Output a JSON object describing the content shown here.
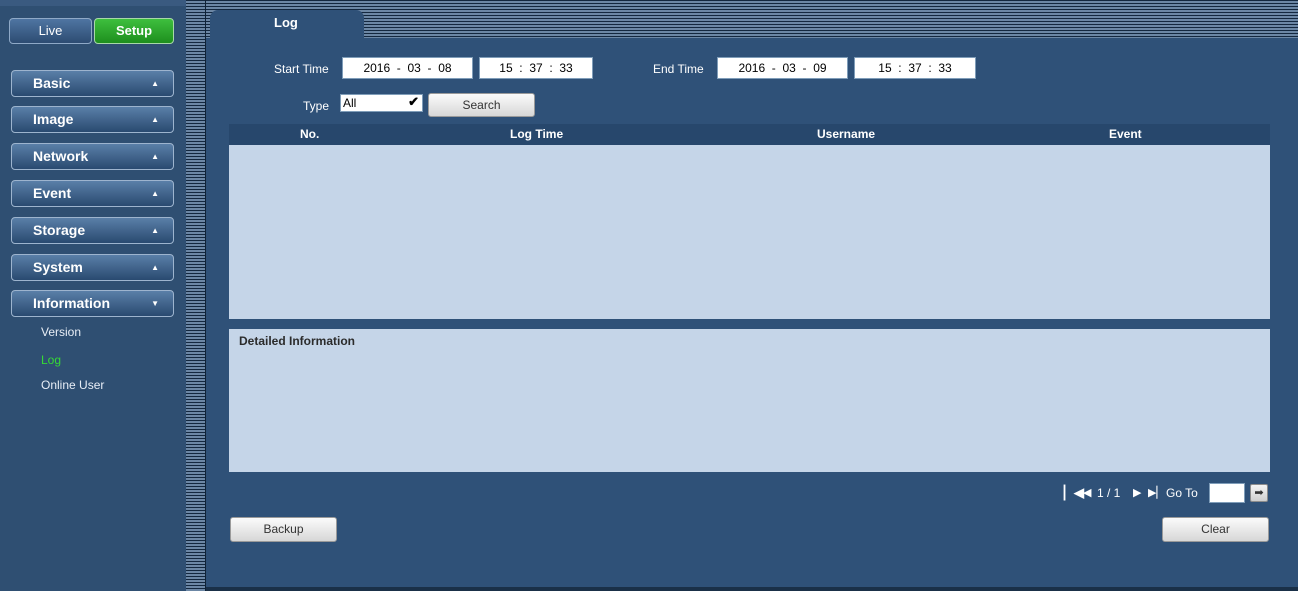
{
  "topnav": {
    "live_label": "Live",
    "setup_label": "Setup"
  },
  "sidebar": {
    "menus": [
      {
        "label": "Basic",
        "arrow": "▲"
      },
      {
        "label": "Image",
        "arrow": "▲"
      },
      {
        "label": "Network",
        "arrow": "▲"
      },
      {
        "label": "Event",
        "arrow": "▲"
      },
      {
        "label": "Storage",
        "arrow": "▲"
      },
      {
        "label": "System",
        "arrow": "▲"
      },
      {
        "label": "Information",
        "arrow": "▼"
      }
    ],
    "submenu": [
      {
        "label": "Version"
      },
      {
        "label": "Log"
      },
      {
        "label": "Online User"
      }
    ]
  },
  "tab": {
    "label": "Log"
  },
  "filters": {
    "start_label": "Start Time",
    "start_date": {
      "year": "2016",
      "month": "03",
      "day": "08"
    },
    "start_time": {
      "h": "15",
      "m": "37",
      "s": "33"
    },
    "end_label": "End Time",
    "end_date": {
      "year": "2016",
      "month": "03",
      "day": "09"
    },
    "end_time": {
      "h": "15",
      "m": "37",
      "s": "33"
    },
    "type_label": "Type",
    "type_value": "All",
    "search_label": "Search"
  },
  "table": {
    "columns": [
      "No.",
      "Log Time",
      "Username",
      "Event"
    ]
  },
  "detail": {
    "title": "Detailed Information"
  },
  "pager": {
    "page_text": "1 / 1",
    "goto_label": "Go To",
    "goto_value": ""
  },
  "actions": {
    "backup_label": "Backup",
    "clear_label": "Clear"
  },
  "colors": {
    "active_submenu": "#35d935",
    "setup_active": "#22a322",
    "panel_bg": "#c5d5e8",
    "main_bg": "#2f5178"
  }
}
